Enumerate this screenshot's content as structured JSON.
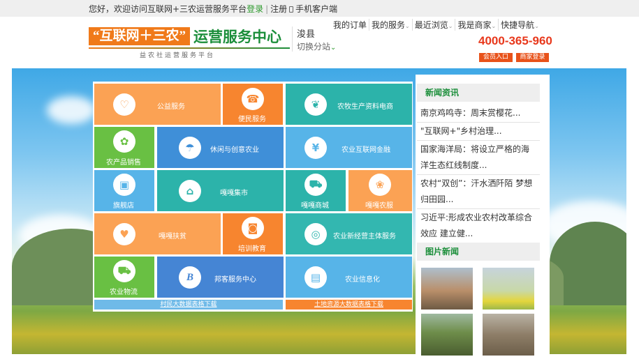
{
  "topbar": {
    "greeting": "您好，欢迎访问互联网+三农运营服务平台",
    "login": "登录",
    "separator": "|",
    "register": "注册",
    "mobile_client": "手机客户端"
  },
  "header": {
    "logo_main": "“互联网＋三农”",
    "logo_text": "运营服务中心",
    "logo_sub": "益农社运营服务平台",
    "city": "浚县",
    "city_switch": "切换分站",
    "nav": [
      {
        "label": "我的订单",
        "dropdown": false
      },
      {
        "label": "我的服务",
        "dropdown": true
      },
      {
        "label": "最近浏览",
        "dropdown": true
      },
      {
        "label": "我是商家",
        "dropdown": true
      },
      {
        "label": "快捷导航",
        "dropdown": true
      }
    ],
    "hotline": "4000-365-960",
    "member_entry": "会员入口",
    "merchant_login": "商家登录"
  },
  "tiles": [
    {
      "label": "公益服务",
      "icon": "heart-hands-icon",
      "glyph": "♡",
      "color": "#fba254"
    },
    {
      "label": "便民服务",
      "icon": "telephone-icon",
      "glyph": "☎",
      "color": "#f7852f"
    },
    {
      "label": "农牧生产资料电商",
      "icon": "sprout-icon",
      "glyph": "❦",
      "color": "#2cb3aa"
    },
    {
      "label": "农产品销售",
      "icon": "wheat-icon",
      "glyph": "✿",
      "color": "#69c043"
    },
    {
      "label": "休闲与创意农业",
      "icon": "beach-umbrella-icon",
      "glyph": "☂",
      "color": "#3f8fd8"
    },
    {
      "label": "农业互联网金融",
      "icon": "yen-icon",
      "glyph": "¥",
      "color": "#57b4e8"
    },
    {
      "label": "旗舰店",
      "icon": "shopping-bag-icon",
      "glyph": "▣",
      "color": "#57b4e8"
    },
    {
      "label": "嘎嘎集市",
      "icon": "storefront-icon",
      "glyph": "⌂",
      "color": "#2cb3aa"
    },
    {
      "label": "嘎嘎商城",
      "icon": "shopping-cart-icon",
      "glyph": "⛟",
      "color": "#2cb3aa"
    },
    {
      "label": "嘎嘎农服",
      "icon": "plant-hand-icon",
      "glyph": "❀",
      "color": "#fba254"
    },
    {
      "label": "嘎嘎扶贫",
      "icon": "heart-hand-icon",
      "glyph": "♥",
      "color": "#fba254"
    },
    {
      "label": "培训教育",
      "icon": "presentation-icon",
      "glyph": "◙",
      "color": "#f7852f"
    },
    {
      "label": "农业新经营主体服务",
      "icon": "swirl-icon",
      "glyph": "◎",
      "color": "#33b7b0"
    },
    {
      "label": "农业物流",
      "icon": "truck-icon",
      "glyph": "⛟",
      "color": "#69c043"
    },
    {
      "label": "邦客服务中心",
      "icon": "b-logo-icon",
      "glyph": "B",
      "color": "#4585d4"
    },
    {
      "label": "农业信息化",
      "icon": "document-icon",
      "glyph": "▤",
      "color": "#57b4e8"
    }
  ],
  "downloads": {
    "villager": "村民大数据表格下载",
    "land": "土地资源大数据表格下载"
  },
  "news": {
    "title": "新闻资讯",
    "items": [
      "南京鸡鸣寺：周末赏樱花...",
      "\"互联网+\"乡村治理...",
      "国家海洋局：将设立严格的海洋生态红线制度...",
      "农村“双创”：汗水洒阡陌 梦想归田园...",
      "习近平:形成农业农村改革综合效应 建立健..."
    ],
    "photo_title": "图片新闻",
    "photos": [
      "cotton-photo",
      "crop-drone-photo",
      "cattle-field-photo",
      "livestock-pens-photo"
    ]
  }
}
